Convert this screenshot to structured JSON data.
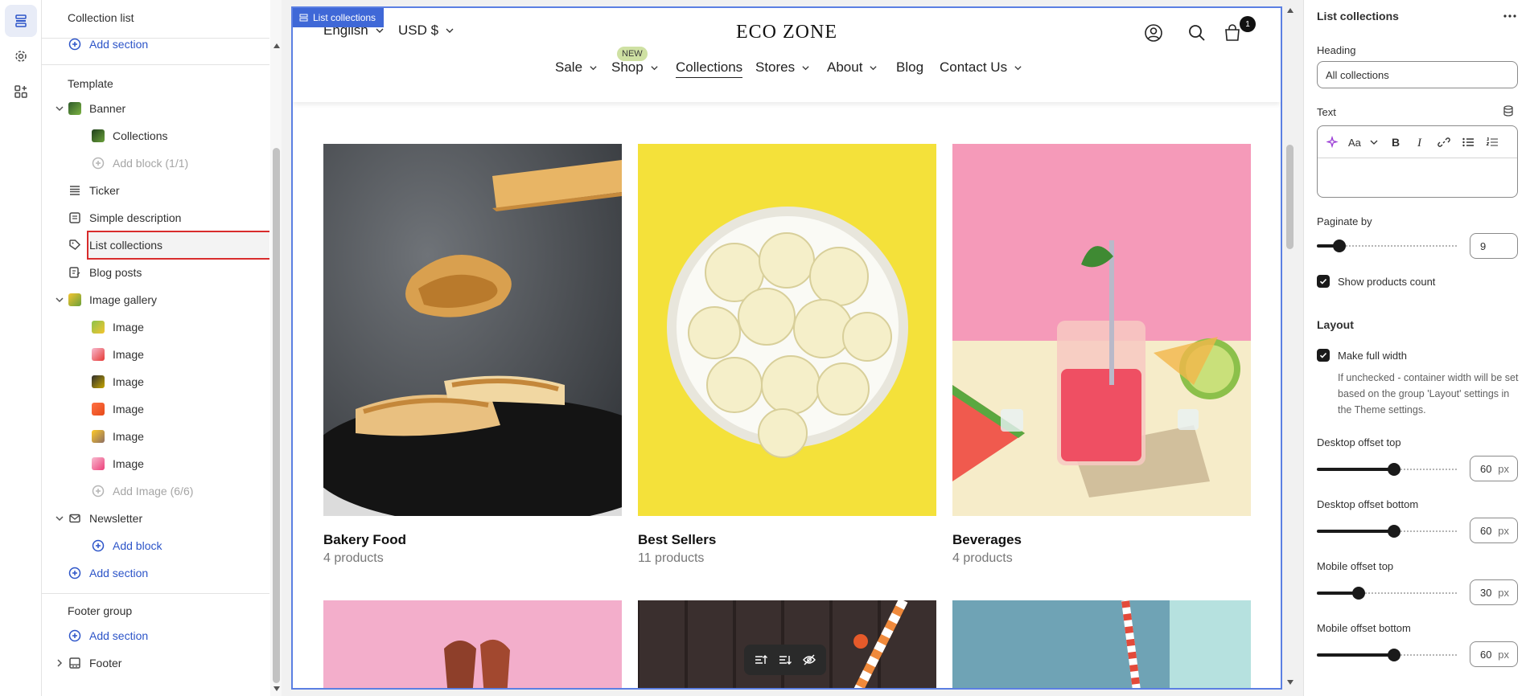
{
  "sidebar": {
    "title": "Collection list",
    "add_section_top": "Add section",
    "template_label": "Template",
    "items": [
      {
        "label": "Banner"
      },
      {
        "label": "Collections"
      },
      {
        "label": "Add block (1/1)"
      },
      {
        "label": "Ticker"
      },
      {
        "label": "Simple description"
      },
      {
        "label": "List collections"
      },
      {
        "label": "Blog posts"
      },
      {
        "label": "Image gallery"
      },
      {
        "label": "Image"
      },
      {
        "label": "Image"
      },
      {
        "label": "Image"
      },
      {
        "label": "Image"
      },
      {
        "label": "Image"
      },
      {
        "label": "Image"
      },
      {
        "label": "Add Image (6/6)"
      },
      {
        "label": "Newsletter"
      },
      {
        "label": "Add block"
      },
      {
        "label": "Add section"
      }
    ],
    "footer_group_label": "Footer group",
    "footer_add_section": "Add section",
    "footer_label": "Footer"
  },
  "preview": {
    "badge": "List collections",
    "language": "English",
    "currency": "USD $",
    "logo": "ECO ZONE",
    "cart_count": "1",
    "new_badge": "NEW",
    "nav": [
      "Sale",
      "Shop",
      "Collections",
      "Stores",
      "About",
      "Blog",
      "Contact Us"
    ],
    "collections": [
      {
        "title": "Bakery Food",
        "count": "4 products"
      },
      {
        "title": "Best Sellers",
        "count": "11 products"
      },
      {
        "title": "Beverages",
        "count": "4 products"
      }
    ]
  },
  "panel": {
    "title": "List collections",
    "heading_label": "Heading",
    "heading_value": "All collections",
    "text_label": "Text",
    "paginate_label": "Paginate by",
    "paginate_value": "9",
    "paginate_fill": 0.16,
    "show_count_label": "Show products count",
    "show_count_checked": true,
    "layout_label": "Layout",
    "full_width_label": "Make full width",
    "full_width_checked": true,
    "full_width_help": "If unchecked - container width will be set based on the group 'Layout' settings in the Theme settings.",
    "desktop_top_label": "Desktop offset top",
    "desktop_top_value": "60",
    "desktop_bottom_label": "Desktop offset bottom",
    "desktop_bottom_value": "60",
    "mobile_top_label": "Mobile offset top",
    "mobile_top_value": "30",
    "mobile_bottom_label": "Mobile offset bottom",
    "mobile_bottom_value": "60",
    "unit": "px"
  }
}
